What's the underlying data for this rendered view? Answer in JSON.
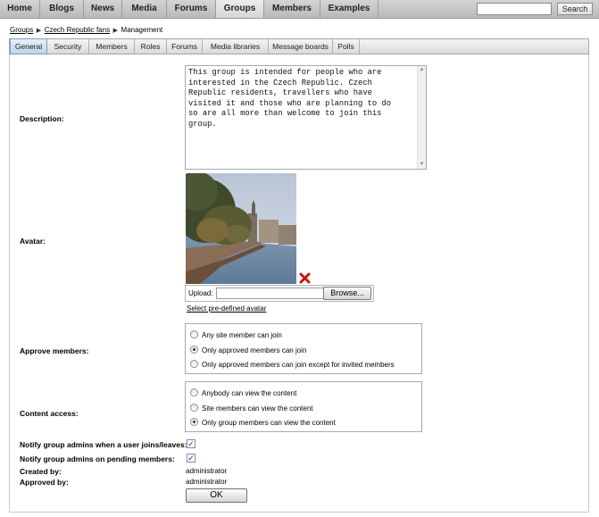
{
  "topnav": {
    "items": [
      {
        "label": "Home"
      },
      {
        "label": "Blogs"
      },
      {
        "label": "News"
      },
      {
        "label": "Media"
      },
      {
        "label": "Forums"
      },
      {
        "label": "Groups",
        "active": true
      },
      {
        "label": "Members"
      },
      {
        "label": "Examples"
      }
    ],
    "search_value": "",
    "search_button": "Search"
  },
  "breadcrumb": [
    "Groups",
    "Czech Republic fans",
    "Management"
  ],
  "tabs": [
    {
      "label": "General",
      "active": true
    },
    {
      "label": "Security"
    },
    {
      "label": "Members"
    },
    {
      "label": "Roles"
    },
    {
      "label": "Forums"
    },
    {
      "label": "Media libraries"
    },
    {
      "label": "Message boards"
    },
    {
      "label": "Polls"
    }
  ],
  "form": {
    "description_label": "Description:",
    "description_value": "This group is intended for people who are\ninterested in the Czech Republic. Czech\nRepublic residents, travellers who have\nvisited it and those who are planning to do\nso are all more than welcome to join this\ngroup.",
    "avatar_label": "Avatar:",
    "upload_label": "Upload:",
    "browse_button": "Browse...",
    "predefined_avatar_link": "Select pre-defined avatar",
    "approve_label": "Approve members:",
    "approve_options": [
      {
        "label": "Any site member can join",
        "checked": false
      },
      {
        "label": "Only approved members can join",
        "checked": true
      },
      {
        "label": "Only approved members can join except for invited members",
        "checked": false
      }
    ],
    "content_label": "Content access:",
    "content_options": [
      {
        "label": "Anybody can view the content",
        "checked": false
      },
      {
        "label": "Site members can view the content",
        "checked": false
      },
      {
        "label": "Only group members can view the content",
        "checked": true
      }
    ],
    "notify_joins_label": "Notify group admins when a user joins/leaves:",
    "notify_joins_checked": true,
    "notify_pending_label": "Notify group admins on pending members:",
    "notify_pending_checked": true,
    "created_by_label": "Created by:",
    "created_by_value": "administrator",
    "approved_by_label": "Approved by:",
    "approved_by_value": "administrator",
    "ok_button": "OK"
  },
  "colors": {
    "nav_bg": "#c4c4c4",
    "tab_active": "#c8d8ee",
    "delete_icon": "#cc0000"
  },
  "icons": {
    "delete": "delete-x-icon",
    "breadcrumb_separator": "triangle-right-icon"
  }
}
